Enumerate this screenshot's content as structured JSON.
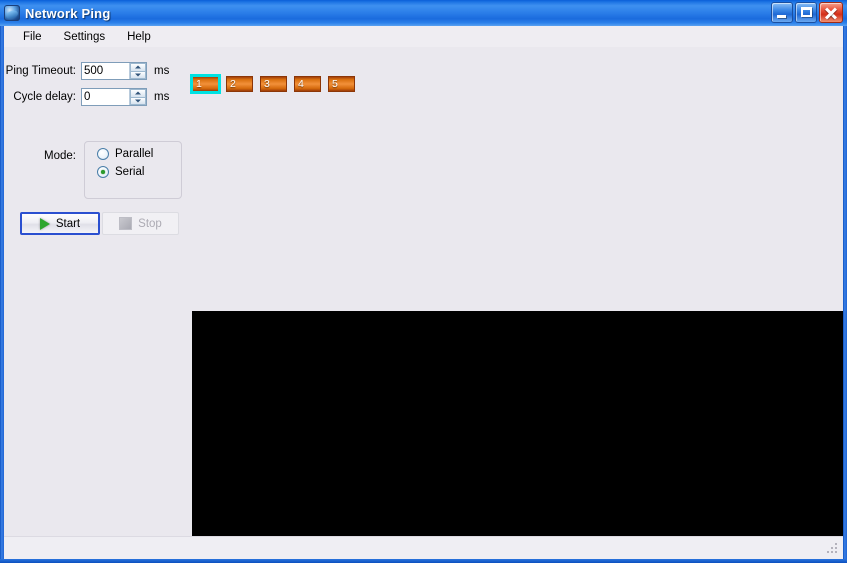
{
  "window": {
    "title": "Network Ping",
    "icon": "app-globe-icon",
    "controls": {
      "minimize": "minimize-button",
      "maximize": "maximize-button",
      "close": "close-button"
    }
  },
  "menubar": {
    "items": [
      {
        "label": "File"
      },
      {
        "label": "Settings"
      },
      {
        "label": "Help"
      }
    ]
  },
  "form": {
    "ping_timeout": {
      "label": "Ping Timeout:",
      "value": "500",
      "unit": "ms"
    },
    "cycle_delay": {
      "label": "Cycle delay:",
      "value": "0",
      "unit": "ms"
    },
    "mode": {
      "label": "Mode:",
      "options": [
        {
          "label": "Parallel",
          "selected": false
        },
        {
          "label": "Serial",
          "selected": true
        }
      ]
    }
  },
  "actions": {
    "start": {
      "label": "Start",
      "enabled": true,
      "focused": true
    },
    "stop": {
      "label": "Stop",
      "enabled": false,
      "focused": false
    }
  },
  "hosts": {
    "buttons": [
      {
        "label": "1",
        "selected": true
      },
      {
        "label": "2",
        "selected": false
      },
      {
        "label": "3",
        "selected": false
      },
      {
        "label": "4",
        "selected": false
      },
      {
        "label": "5",
        "selected": false
      }
    ]
  },
  "console": {
    "content": "",
    "background": "#000000"
  },
  "colors": {
    "titlebar_blue": "#2A7DE8",
    "client_background": "#EAE8EE",
    "host_orange": "#D9700F",
    "host_selected_outline": "#00E2E2",
    "start_focus_border": "#2A4FD0",
    "play_green": "#2EA62E",
    "radio_dot_green": "#2C9B2C",
    "close_red": "#D22E18"
  }
}
